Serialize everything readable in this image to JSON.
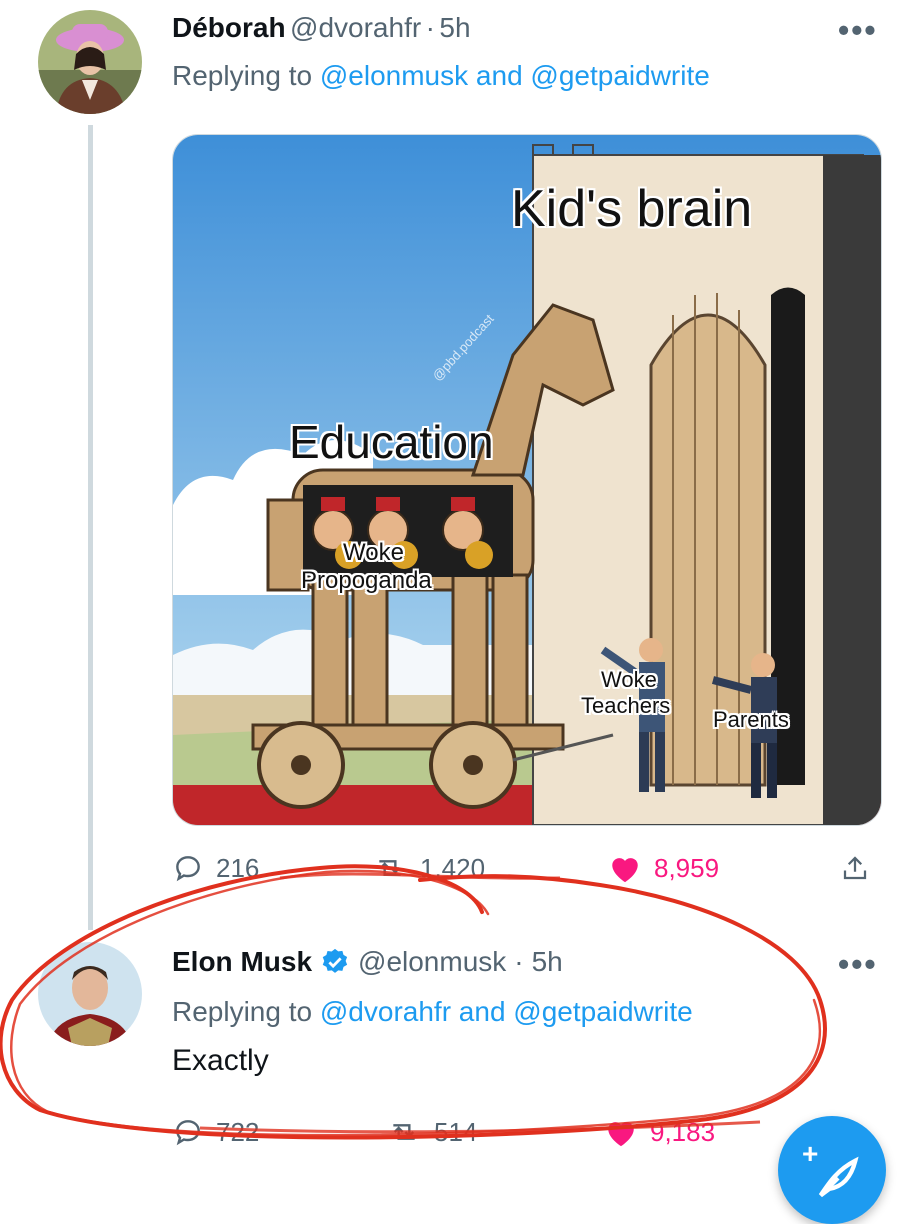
{
  "tweets": [
    {
      "display_name": "Déborah",
      "handle": "@dvorahfr",
      "separator": "·",
      "time": "5h",
      "reply_prefix": "Replying to",
      "mention_1": "@elonmusk",
      "conjunction": "and",
      "mention_2": "@getpaidwrite",
      "more_icon": "more-horizontal-icon",
      "media": {
        "label_top": "Kid's brain",
        "label_horse": "Education",
        "label_soldiers_1": "Woke",
        "label_soldiers_2": "Propoganda",
        "label_teachers_1": "Woke",
        "label_teachers_2": "Teachers",
        "label_parents": "Parents",
        "watermark": "@pbd.podcast"
      },
      "actions": {
        "replies": "216",
        "retweets": "1,420",
        "likes": "8,959",
        "liked": true
      }
    },
    {
      "display_name": "Elon Musk",
      "verified": true,
      "handle": "@elonmusk",
      "separator": "·",
      "time": "5h",
      "reply_prefix": "Replying to",
      "mention_1": "@dvorahfr",
      "conjunction": "and",
      "mention_2": "@getpaidwrite",
      "text": "Exactly",
      "more_icon": "more-horizontal-icon",
      "actions": {
        "replies": "722",
        "retweets": "514",
        "likes": "9,183",
        "liked": true
      }
    }
  ],
  "fab": {
    "icon": "compose-tweet-icon",
    "plus": "+"
  },
  "colors": {
    "accent": "#1d9bf0",
    "like": "#f91880",
    "secondary_text": "#536471",
    "annotation_red": "#e0301e"
  }
}
